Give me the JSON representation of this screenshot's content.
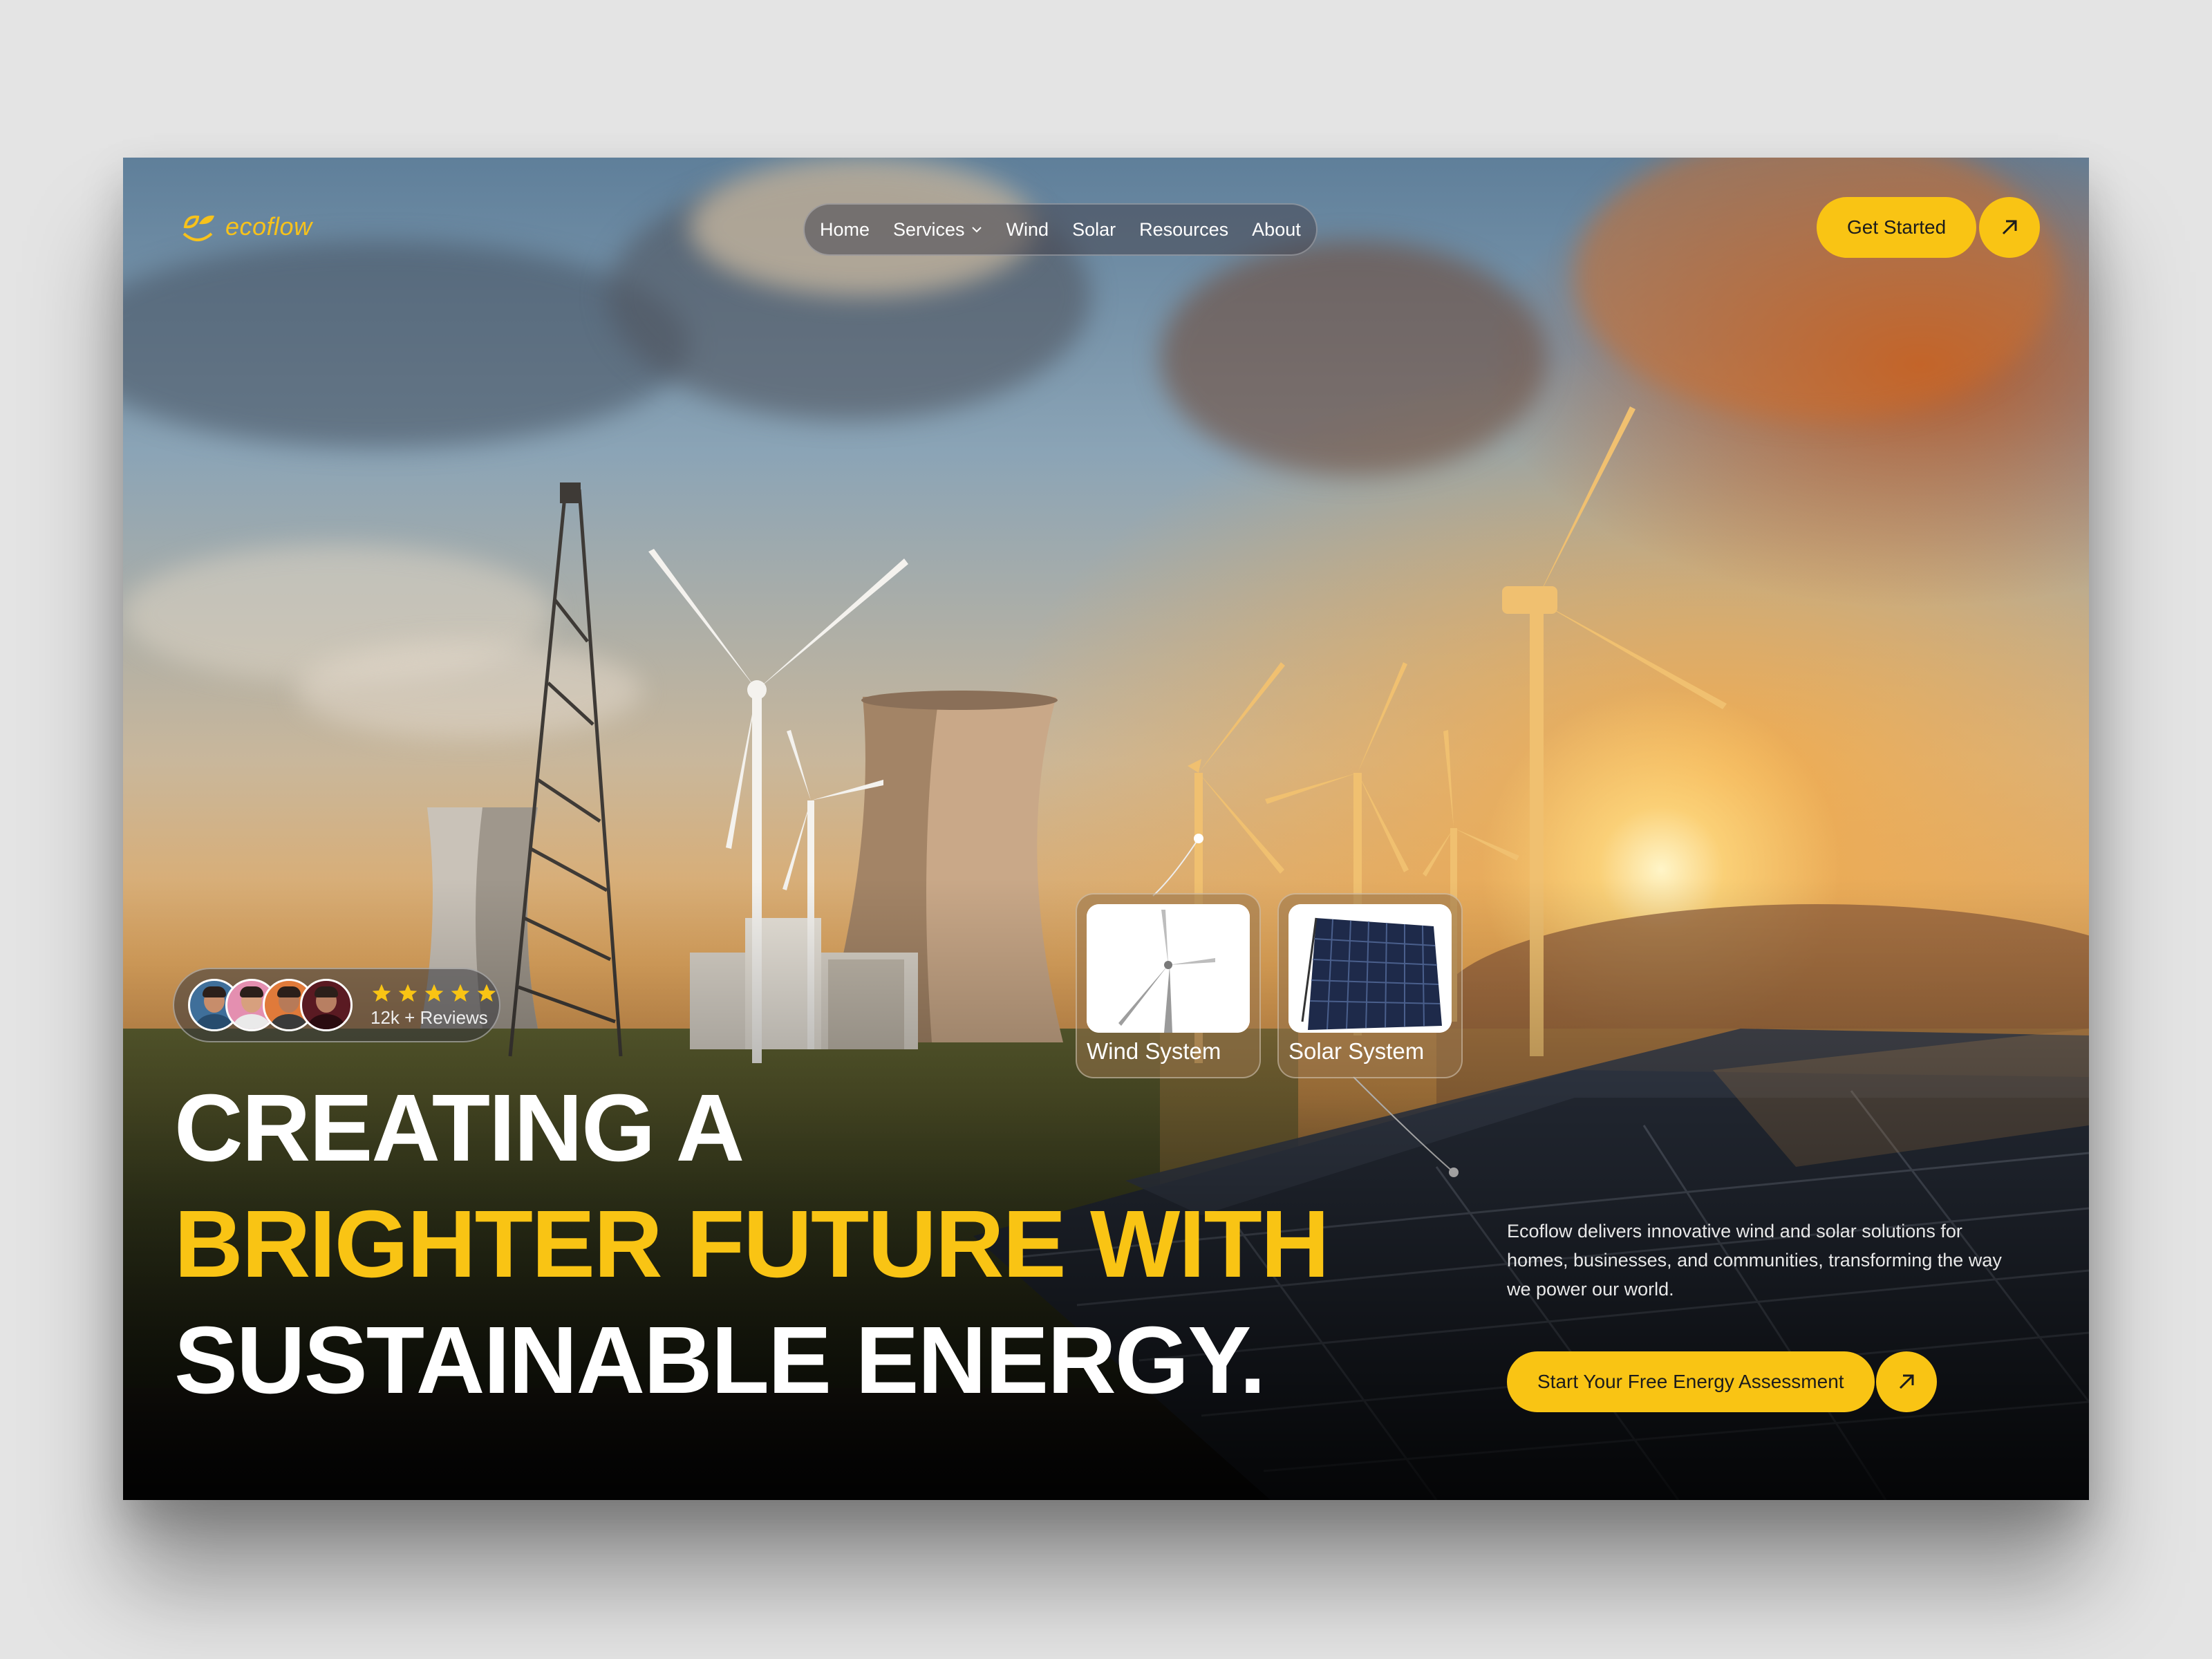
{
  "brand": {
    "name": "ecoflow",
    "accent_color": "#f9c414"
  },
  "nav": {
    "items": [
      {
        "label": "Home",
        "dropdown": false
      },
      {
        "label": "Services",
        "dropdown": true
      },
      {
        "label": "Wind",
        "dropdown": false
      },
      {
        "label": "Solar",
        "dropdown": false
      },
      {
        "label": "Resources",
        "dropdown": false
      },
      {
        "label": "About",
        "dropdown": false
      }
    ]
  },
  "header_cta": {
    "label": "Get Started",
    "icon": "arrow-up-right-icon"
  },
  "reviews": {
    "rating": 5,
    "label": "12k + Reviews",
    "avatar_count": 4
  },
  "hero": {
    "line1": "CREATING A",
    "line2": "BRIGHTER FUTURE WITH",
    "line3": "SUSTAINABLE ENERGY."
  },
  "cards": [
    {
      "label": "Wind System",
      "icon": "wind-turbine-icon"
    },
    {
      "label": "Solar System",
      "icon": "solar-panel-icon"
    }
  ],
  "description": "Ecoflow delivers innovative wind and solar solutions for homes, businesses, and communities, transforming the way we power our world.",
  "main_cta": {
    "label": "Start Your Free Energy Assessment",
    "icon": "arrow-up-right-icon"
  }
}
